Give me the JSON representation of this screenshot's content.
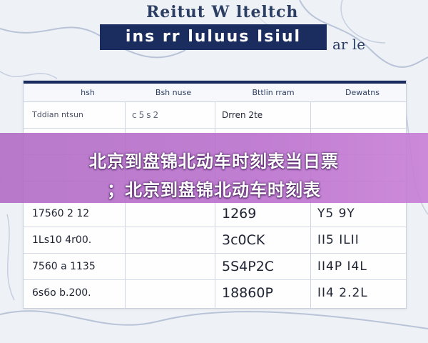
{
  "poster": {
    "title_top": "Reitut W lteltch",
    "title_bar": "ins rr luluus Isiul",
    "title_side": "ar le"
  },
  "table": {
    "headers": [
      "hsh",
      "Bsh nuse",
      "Bttlin rram",
      "Dewatns"
    ],
    "rows": [
      [
        "Tddian ntsun",
        "c5s2",
        "Drren 2te",
        ""
      ],
      [
        "",
        "",
        "",
        ""
      ],
      [
        "",
        "",
        "",
        ""
      ],
      [
        "17560 2 12",
        "",
        "1269",
        "Y5  9Y"
      ],
      [
        "1Ls10 4r00.",
        "",
        "3c0CK",
        "II5 ILII"
      ],
      [
        "7560 a 1135",
        "",
        "5S4P2C",
        "II4P  I4L"
      ],
      [
        "6s6o b.200.",
        "",
        "18860P",
        "II4  2.2L"
      ]
    ]
  },
  "banner": {
    "line1": "北京到盘锦北动车时刻表当日票",
    "line2": "；北京到盘锦北动车时刻表"
  },
  "colors": {
    "header_bar": "#1b2d5e",
    "banner": "#b96ccb",
    "text": "#1f2433"
  }
}
